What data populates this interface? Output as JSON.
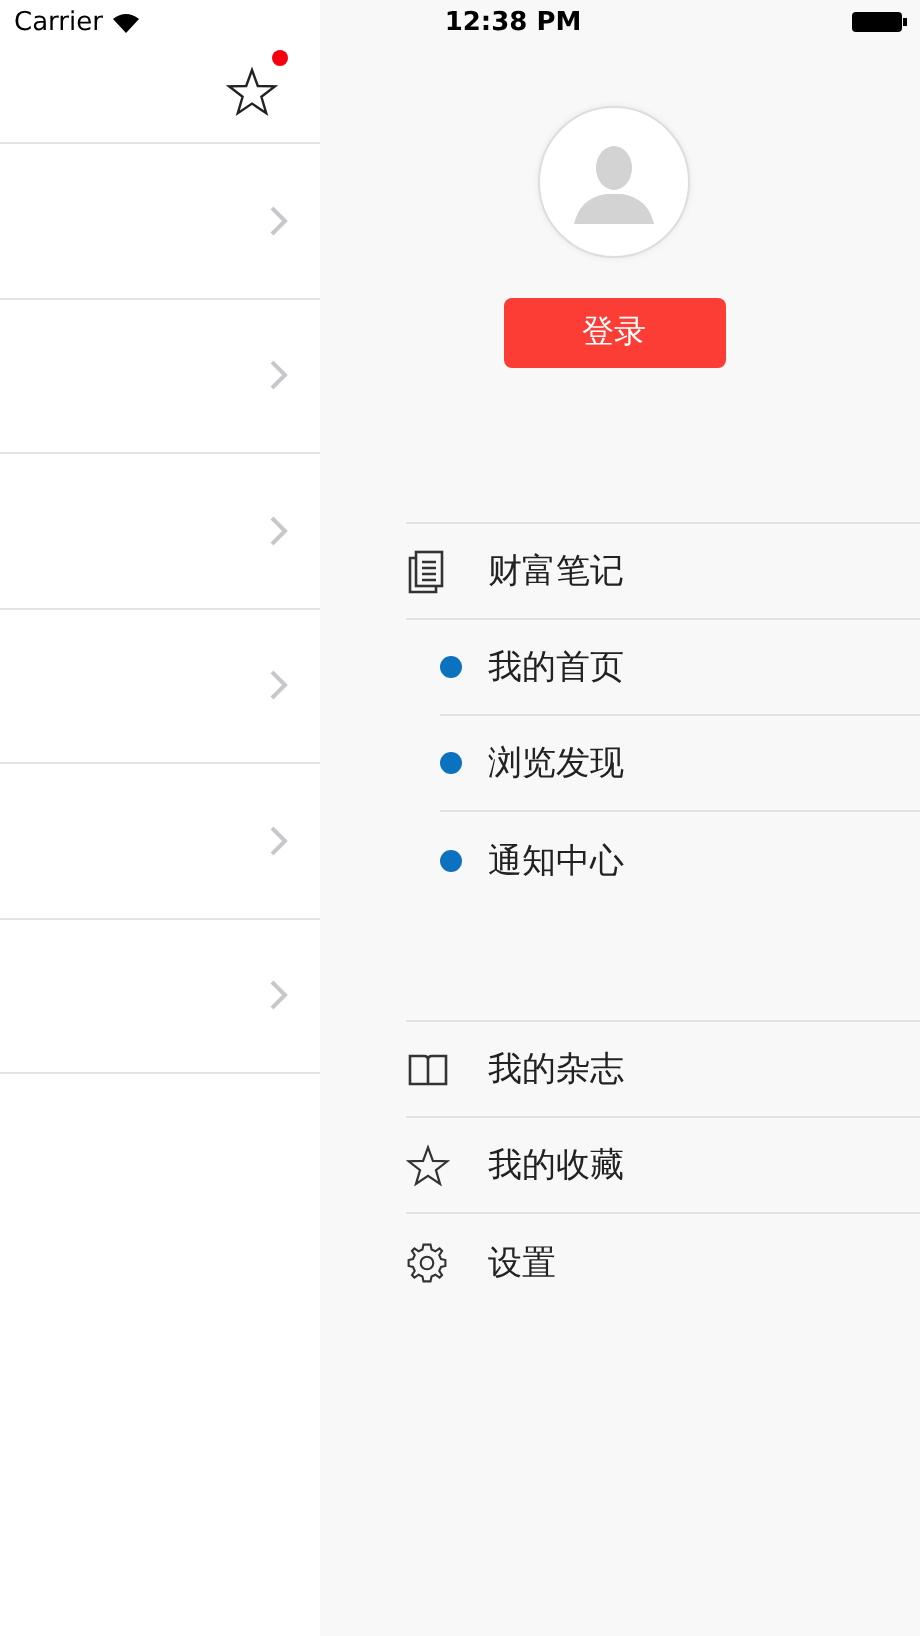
{
  "status_bar": {
    "carrier": "Carrier",
    "time": "12:38 PM"
  },
  "left_panel": {
    "favorites_badge": true,
    "rows": [
      {
        "kind": "chevron"
      },
      {
        "kind": "chevron"
      },
      {
        "kind": "chevron"
      },
      {
        "kind": "chevron"
      },
      {
        "kind": "chevron"
      },
      {
        "kind": "chevron"
      }
    ]
  },
  "drawer": {
    "login_button": "登录",
    "menu_sections": [
      [
        {
          "label": "财富笔记",
          "children": [
            {
              "label": "我的首页"
            },
            {
              "label": "浏览发现"
            },
            {
              "label": "通知中心"
            }
          ]
        }
      ],
      [
        {
          "label": "我的杂志"
        },
        {
          "label": "我的收藏"
        },
        {
          "label": "设置"
        }
      ]
    ]
  }
}
